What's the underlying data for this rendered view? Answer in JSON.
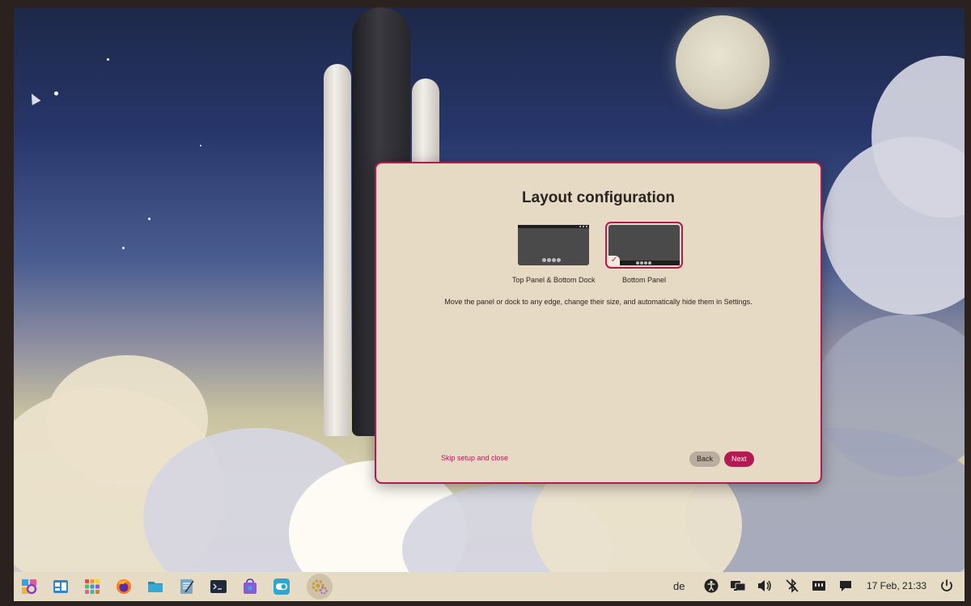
{
  "dialog": {
    "title": "Layout configuration",
    "options": [
      {
        "label": "Top Panel & Bottom Dock",
        "selected": false
      },
      {
        "label": "Bottom Panel",
        "selected": true
      }
    ],
    "check_glyph": "✓",
    "description": "Move the panel or dock to any edge, change their size, and automatically hide them in Settings.",
    "skip_label": "Skip setup and close",
    "back_label": "Back",
    "next_label": "Next"
  },
  "colors": {
    "accent": "#b21b52",
    "dialog_bg": "#e6dac5",
    "taskbar_bg": "#e6dcc6"
  },
  "taskbar": {
    "apps": [
      {
        "icon": "search-app-icon"
      },
      {
        "icon": "window-switcher-icon"
      },
      {
        "icon": "app-grid-icon"
      },
      {
        "icon": "firefox-icon"
      },
      {
        "icon": "files-icon"
      },
      {
        "icon": "text-editor-icon"
      },
      {
        "icon": "terminal-icon"
      },
      {
        "icon": "software-store-icon"
      },
      {
        "icon": "toggle-app-icon"
      },
      {
        "icon": "setup-wizard-icon",
        "active": true
      }
    ],
    "keyboard_layout": "de",
    "tray_icons": [
      "accessibility-icon",
      "display-icon",
      "volume-icon",
      "bluetooth-off-icon",
      "network-icon",
      "notifications-icon"
    ],
    "clock": "17 Feb, 21:33",
    "power_icon": "power-icon"
  }
}
